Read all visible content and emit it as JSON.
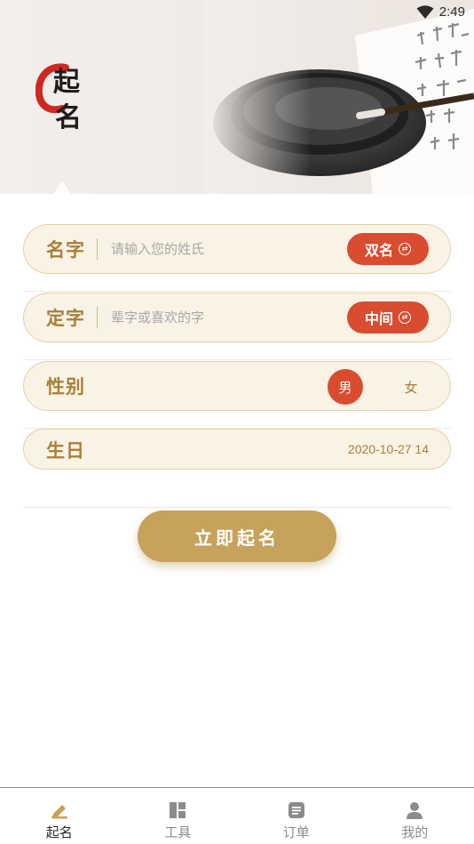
{
  "status_bar": {
    "time": "2:49",
    "wifi_icon": "wifi-icon"
  },
  "hero": {
    "logo_char_1": "起",
    "logo_char_2": "名",
    "logo_ring_color": "#d0281f"
  },
  "form": {
    "name_field": {
      "label": "名字",
      "placeholder": "请输入您的姓氏",
      "value": "",
      "mode_label": "双名",
      "mode_icon": "swap-icon"
    },
    "fixed_char_field": {
      "label": "定字",
      "placeholder": "辈字或喜欢的字",
      "value": "",
      "position_label": "中间",
      "position_icon": "swap-icon"
    },
    "gender_field": {
      "label": "性别",
      "options": [
        "男",
        "女"
      ],
      "selected": "男"
    },
    "birthday_field": {
      "label": "生日",
      "value": "2020-10-27 14"
    },
    "submit_label": "立即起名"
  },
  "bottom_nav": {
    "items": [
      {
        "label": "起名",
        "icon": "pencil-icon",
        "active": true
      },
      {
        "label": "工具",
        "icon": "grid-icon",
        "active": false
      },
      {
        "label": "订单",
        "icon": "list-icon",
        "active": false
      },
      {
        "label": "我的",
        "icon": "user-icon",
        "active": false
      }
    ]
  },
  "colors": {
    "accent_gold": "#a87f37",
    "button_gold": "#c6a25a",
    "accent_red": "#d94c30",
    "field_bg": "#f9f3e6",
    "field_border": "#e4cfa5"
  }
}
